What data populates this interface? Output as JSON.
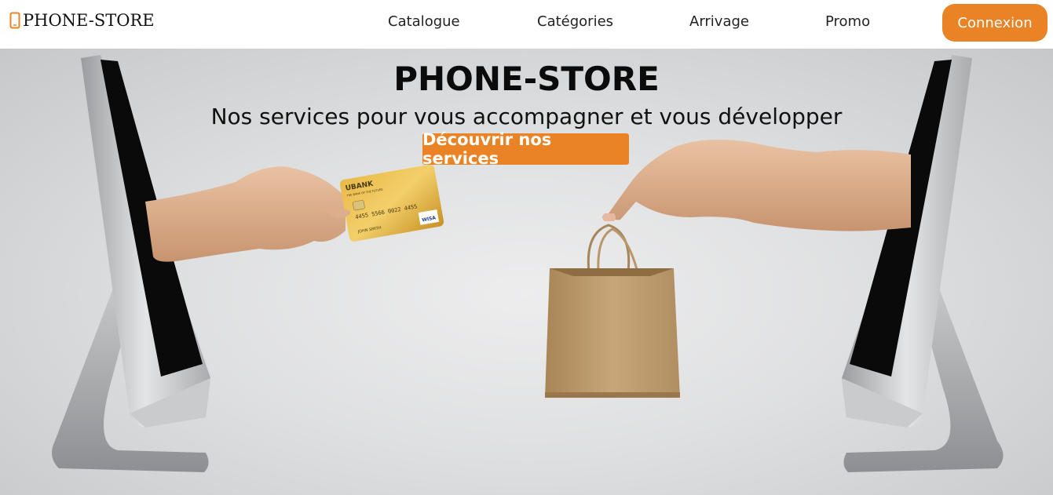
{
  "header": {
    "brand": "PHONE-STORE",
    "nav": [
      {
        "label": "Catalogue"
      },
      {
        "label": "Catégories"
      },
      {
        "label": "Arrivage"
      },
      {
        "label": "Promo"
      }
    ],
    "login_label": "Connexion"
  },
  "hero": {
    "title": "PHONE-STORE",
    "subtitle": "Nos services pour vous accompagner et vous développer",
    "cta_label": "Découvrir nos services",
    "card": {
      "bank": "UBANK",
      "tagline": "THE BANK OF THE FUTURE",
      "number": "4455 5566 0022 4455",
      "holder": "JOHN SMITH",
      "network": "WISA"
    }
  },
  "colors": {
    "accent": "#e98325"
  },
  "icons": {
    "brand": "phone-icon"
  }
}
